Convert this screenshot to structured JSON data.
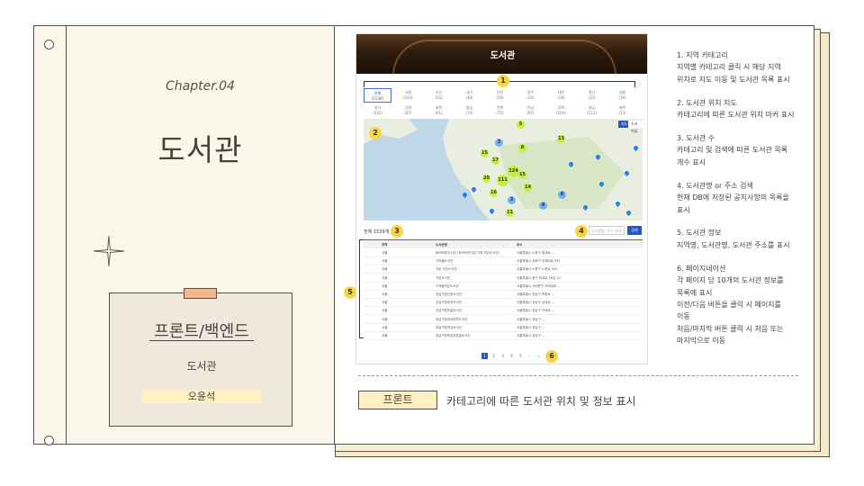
{
  "left_page": {
    "chapter": "Chapter.04",
    "title": "도서관",
    "card_heading": "프론트/백엔드",
    "card_subtitle": "도서관",
    "card_name": "오윤석"
  },
  "screenshot": {
    "banner_title": "도서관",
    "categories": [
      {
        "name": "전체",
        "count": "(1539)",
        "selected": true
      },
      {
        "name": "서울",
        "count": "(163)"
      },
      {
        "name": "부산",
        "count": "(52)"
      },
      {
        "name": "대구",
        "count": "(40)"
      },
      {
        "name": "인천",
        "count": "(59)"
      },
      {
        "name": "광주",
        "count": "(24)"
      },
      {
        "name": "대전",
        "count": "(28)"
      },
      {
        "name": "울산",
        "count": "(22)"
      },
      {
        "name": "세종",
        "count": "(19)"
      },
      {
        "name": "경기",
        "count": "(332)"
      },
      {
        "name": "강원",
        "count": "(87)"
      },
      {
        "name": "충북",
        "count": "(61)"
      },
      {
        "name": "충남",
        "count": "(74)"
      },
      {
        "name": "전북",
        "count": "(75)"
      },
      {
        "name": "전남",
        "count": "(97)"
      },
      {
        "name": "경북",
        "count": "(104)"
      },
      {
        "name": "경남",
        "count": "(111)"
      },
      {
        "name": "제주",
        "count": "(23)"
      }
    ],
    "map_buttons": [
      "지도",
      "스카이뷰"
    ],
    "clusters": [
      "5",
      "3",
      "13",
      "15",
      "8",
      "17",
      "124",
      "111",
      "15",
      "20",
      "16",
      "3",
      "14",
      "11",
      "4",
      "6"
    ],
    "count_text": "전체 1539개 기관",
    "search_placeholder": "도서관명, 주소 검색",
    "search_button": "검색",
    "table_headers": [
      "지역",
      "도서관명",
      "주소"
    ],
    "table_rows": [
      [
        "서울",
        "BBS희망도서관 (한국어린이집 가정 작은도서관)",
        "서울특별시 노원구 월계로 ..."
      ],
      [
        "서울",
        "가락몰도서관",
        "서울특별시 송파구 양재대로 932"
      ],
      [
        "서울",
        "가온 작은도서관",
        "서울특별시 노원구 노원로 520"
      ],
      [
        "서울",
        "가온도서관",
        "서울특별시 중구 퇴계로 16길 10"
      ],
      [
        "서울",
        "가재울작은도서관",
        "서울특별시 서대문구 모래내로 ..."
      ],
      [
        "서울",
        "강남구립논현도서관",
        "서울특별시 강남구 학동로 ..."
      ],
      [
        "서울",
        "강남구립대치도서관",
        "서울특별시 강남구 삼성로 ..."
      ],
      [
        "서울",
        "강남구립못골도서관",
        "서울특별시 강남구 자곡로 ..."
      ],
      [
        "서울",
        "강남구립세곡마루도서관",
        "서울특별시 강남구 ..."
      ],
      [
        "서울",
        "강남구립역삼도서관",
        "서울특별시 강남구 ..."
      ],
      [
        "서울",
        "강남구립역삼푸른솔도서관",
        "서울특별시 강남구 ..."
      ]
    ],
    "pagination": [
      "1",
      "2",
      "3",
      "4",
      "5",
      "›",
      "»"
    ],
    "markers": [
      "1",
      "2",
      "3",
      "4",
      "5",
      "6"
    ]
  },
  "description": [
    {
      "title": "1. 지역 카테고리",
      "lines": [
        "지역별 카테고리 클릭 시 해당 지역",
        "위치로 지도 이동 및 도서관 목록 표시"
      ]
    },
    {
      "title": "2. 도서관 위치 지도",
      "lines": [
        "카테고리에 따른 도서관 위치 마커 표시"
      ]
    },
    {
      "title": "3. 도서관 수",
      "lines": [
        "카테고리 및 검색에 따른 도서관 목록",
        "개수 표시"
      ]
    },
    {
      "title": "4. 도서관명 or 주소 검색",
      "lines": [
        "현재 DB에 저장된 공지사항의 목록을",
        "표시"
      ]
    },
    {
      "title": "5. 도서관 정보",
      "lines": [
        "지역명, 도서관명, 도서관 주소를 표시"
      ]
    },
    {
      "title": "6. 페이지네이션",
      "lines": [
        "각 페이지 당 10개의 도서관 정보를",
        "목록에 표시",
        "이전/다음 버튼을 클릭 시 페이지를",
        "이동",
        "처음/마지막 버튼 클릭 시 처음 또는",
        "마지막으로 이동"
      ]
    }
  ],
  "footer": {
    "tag": "프론트",
    "caption": "카테고리에 따른 도서관 위치 및 정보 표시"
  },
  "colors": {
    "accent_yellow": "#f7d547",
    "tag_bg": "#fdf0c2",
    "tape": "#f3b98c",
    "primary_blue": "#2a55c8",
    "cluster_green": "#c6ee3a"
  }
}
